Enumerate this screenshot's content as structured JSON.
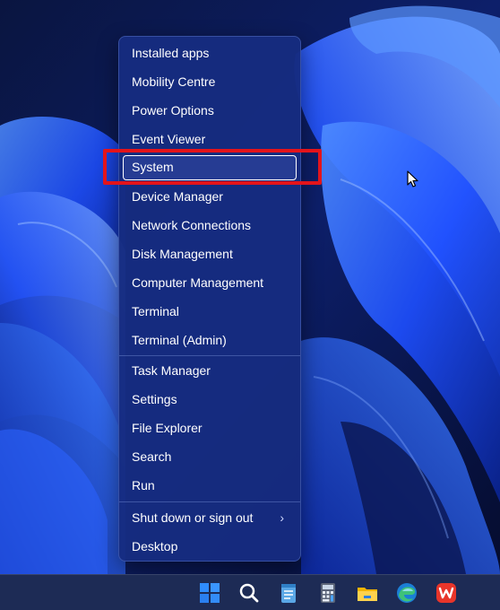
{
  "context_menu": {
    "groups": [
      {
        "items": [
          {
            "label": "Installed apps"
          },
          {
            "label": "Mobility Centre"
          },
          {
            "label": "Power Options"
          },
          {
            "label": "Event Viewer"
          },
          {
            "label": "System",
            "selected": true
          },
          {
            "label": "Device Manager"
          },
          {
            "label": "Network Connections"
          },
          {
            "label": "Disk Management"
          },
          {
            "label": "Computer Management"
          },
          {
            "label": "Terminal"
          },
          {
            "label": "Terminal (Admin)"
          }
        ]
      },
      {
        "items": [
          {
            "label": "Task Manager"
          },
          {
            "label": "Settings"
          },
          {
            "label": "File Explorer"
          },
          {
            "label": "Search"
          },
          {
            "label": "Run"
          }
        ]
      },
      {
        "items": [
          {
            "label": "Shut down or sign out",
            "submenu_indicator": "›"
          },
          {
            "label": "Desktop"
          }
        ]
      }
    ]
  },
  "annotation": {
    "highlight_color": "#e3141b",
    "target": "System"
  },
  "taskbar": {
    "icons": [
      {
        "name": "windows-start-icon"
      },
      {
        "name": "search-icon"
      },
      {
        "name": "notepad-icon"
      },
      {
        "name": "calculator-icon"
      },
      {
        "name": "file-explorer-icon"
      },
      {
        "name": "edge-browser-icon"
      },
      {
        "name": "wps-office-icon"
      }
    ]
  },
  "colors": {
    "menu_background": "#162c80",
    "accent": "#1a44ff",
    "taskbar_background": "#1d2b55"
  }
}
